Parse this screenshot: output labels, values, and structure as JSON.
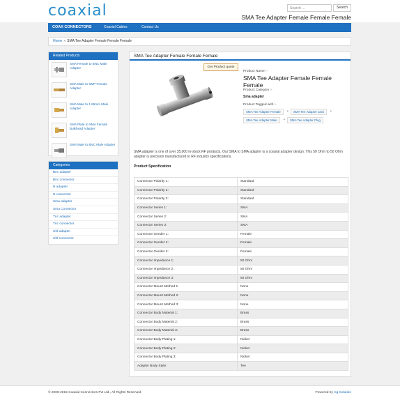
{
  "header": {
    "logo_text": "coaxial",
    "search_placeholder": "Search ...",
    "search_button": "Search",
    "page_heading": "SMA Tee Adapter Female Female Female"
  },
  "nav": {
    "brand": "COAX CONNECTORS",
    "items": [
      "Coaxial Cables",
      "Contact Us"
    ]
  },
  "breadcrumb": {
    "home": "Home",
    "current": "SMA Tee Adapter Female Female Female"
  },
  "related": {
    "title": "Related Products",
    "items": [
      "SMA Female to BNC Male Adapter",
      "SMA Male to SMP Female Adapter",
      "SMA Male to 1.85mm Male Adapter",
      "SMA Plate to SMA Female Bulkhead Adapter",
      "SMA Male to BNC Male Adapter"
    ]
  },
  "categories": {
    "title": "Categories",
    "items": [
      "Bnc adapter",
      "Bnc connector",
      "N adapter",
      "N connector",
      "Sma adapter",
      "Sma Connector",
      "Tnc adapter",
      "Tnc connector",
      "Uhf adapter",
      "Uhf connector"
    ]
  },
  "product": {
    "title": "SMA Tee Adapter Female Female Female",
    "quote_button": "Get Product quote",
    "name_label": "Product Name :-",
    "name": "SMA Tee Adapter Female Female Female",
    "category_label": "Product Category :-",
    "category": "Sma adapter",
    "tags_label": "Product Tagged with :-",
    "tags": [
      "SMA Tee Adapter Female",
      "SMA Tee Adapter Jack",
      "SMA Tee Adapter Male",
      "SMA Tee Adapter Plug"
    ],
    "description": "SMA adapter is one of over 35,000 in-stock RF products. Our SMA to SMA adapter is a coaxial adapter design. This 50 Ohm to 50 Ohm adapter is precision manufactured to RF industry specifications.",
    "spec_heading": "Product Specification",
    "specs": [
      [
        "Connector Polarity 1:",
        "Standard"
      ],
      [
        "Connector Polarity 2:",
        "Standard"
      ],
      [
        "Connector Polarity 3:",
        "Standard"
      ],
      [
        "Connector Series 1:",
        "SMA"
      ],
      [
        "Connector Series 2:",
        "SMA"
      ],
      [
        "Connector Series 3:",
        "SMA"
      ],
      [
        "Connector Gender 1:",
        "Female"
      ],
      [
        "Connector Gender 2:",
        "Female"
      ],
      [
        "Connector Gender 3:",
        "Female"
      ],
      [
        "Connector Impedance 1:",
        "50 Ohm"
      ],
      [
        "Connector Impedance 2:",
        "50 Ohm"
      ],
      [
        "Connector Impedance 3:",
        "50 Ohm"
      ],
      [
        "Connector Mount Method 1:",
        "None"
      ],
      [
        "Connector Mount Method 2:",
        "None"
      ],
      [
        "Connector Mount Method 3:",
        "None"
      ],
      [
        "Connector Body Material 1:",
        "Brass"
      ],
      [
        "Connector Body Material 2:",
        "Brass"
      ],
      [
        "Connector Body Material 3:",
        "Brass"
      ],
      [
        "Connector Body Plating 1:",
        "Nickel"
      ],
      [
        "Connector Body Plating 2:",
        "Nickel"
      ],
      [
        "Connector Body Plating 3:",
        "Nickel"
      ],
      [
        "Adapter Body Style:",
        "Tee"
      ]
    ]
  },
  "footer": {
    "copyright": "© 2008-2015 Coaxial Connectors Pvt Ltd., All Rights Reserved.",
    "powered_prefix": "Powered by",
    "powered_link": "Cg Solution"
  },
  "colors": {
    "accent": "#1e70c0",
    "link": "#1e6fb8",
    "logo": "#2a8fc9"
  }
}
